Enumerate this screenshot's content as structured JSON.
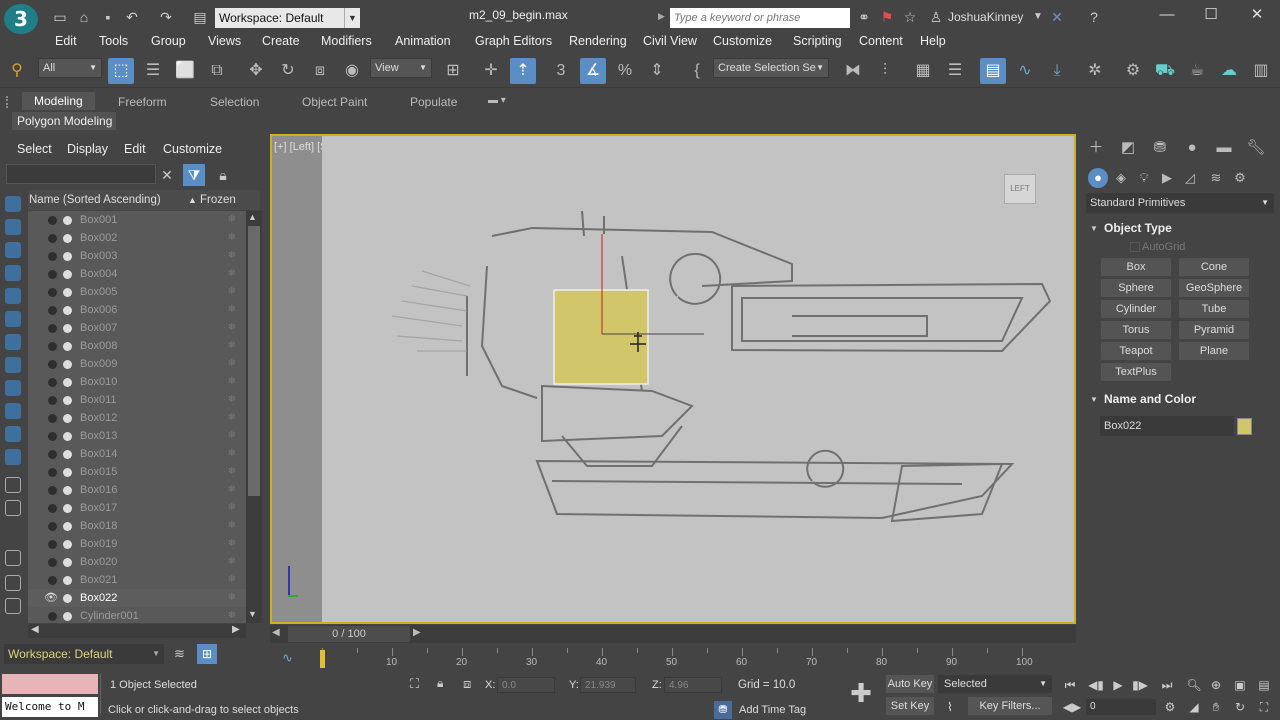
{
  "titlebar": {
    "logo_text": "3",
    "workspace_label": "Workspace: Default",
    "filename": "m2_09_begin.max",
    "search_placeholder": "Type a keyword or phrase",
    "user": "JoshuaKinney"
  },
  "menu": [
    "Edit",
    "Tools",
    "Group",
    "Views",
    "Create",
    "Modifiers",
    "Animation",
    "Graph Editors",
    "Rendering",
    "Civil View",
    "Customize",
    "Scripting",
    "Content",
    "Help"
  ],
  "toolbar": {
    "filter_select": "All",
    "view_select": "View",
    "create_selection_set": "Create Selection Se"
  },
  "ribbon": {
    "tabs": [
      "Modeling",
      "Freeform",
      "Selection",
      "Object Paint",
      "Populate"
    ],
    "active_tab": "Modeling",
    "panel_label": "Polygon Modeling"
  },
  "explorer": {
    "menu": [
      "Select",
      "Display",
      "Edit",
      "Customize"
    ],
    "col_name": "Name (Sorted Ascending)",
    "col_frozen": "Frozen",
    "sort_indicator": "▲",
    "items": [
      "Box001",
      "Box002",
      "Box003",
      "Box004",
      "Box005",
      "Box006",
      "Box007",
      "Box008",
      "Box009",
      "Box010",
      "Box011",
      "Box012",
      "Box013",
      "Box014",
      "Box015",
      "Box016",
      "Box017",
      "Box018",
      "Box019",
      "Box020",
      "Box021",
      "Box022",
      "Cylinder001"
    ],
    "selected_item": "Box022",
    "workspace": "Workspace: Default"
  },
  "viewport": {
    "label": "[+] [Left] [Standard] [Edged Faces]",
    "viewcube_label": "LEFT"
  },
  "command_panel": {
    "dropdown": "Standard Primitives",
    "object_type_title": "Object Type",
    "autogrid": "AutoGrid",
    "buttons": [
      "Box",
      "Cone",
      "Sphere",
      "GeoSphere",
      "Cylinder",
      "Tube",
      "Torus",
      "Pyramid",
      "Teapot",
      "Plane",
      "TextPlus"
    ],
    "name_color_title": "Name and Color",
    "object_name": "Box022",
    "object_color": "#d2c66a"
  },
  "timeline": {
    "slider_label": "0 / 100",
    "ticks": [
      "10",
      "20",
      "30",
      "40",
      "50",
      "60",
      "70",
      "80",
      "90",
      "100"
    ]
  },
  "status": {
    "maxscript_text": "Welcome to M",
    "selected_count": "1 Object Selected",
    "prompt": "Click or click-and-drag to select objects",
    "x_label": "X:",
    "x_value": "0.0",
    "y_label": "Y:",
    "y_value": "21.939",
    "z_label": "Z:",
    "z_value": "4.96",
    "grid": "Grid = 10.0",
    "add_time_tag": "Add Time Tag",
    "auto_key": "Auto Key",
    "set_key": "Set Key",
    "selected_dropdown": "Selected",
    "key_filters": "Key Filters...",
    "frame": "0"
  },
  "colors": {
    "accent": "#5b8ec4",
    "viewport_border": "#c9b22a",
    "box_fill": "#d2c66a",
    "maxscript_bg": "#e7b4b8"
  }
}
